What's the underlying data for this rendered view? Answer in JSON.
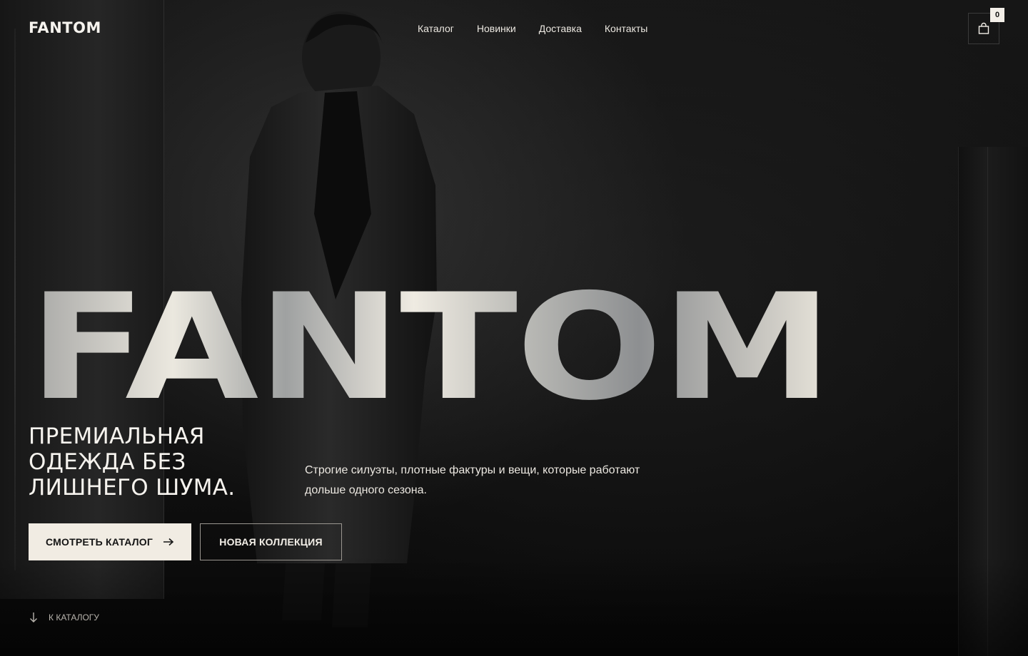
{
  "header": {
    "logo": "FANTOM",
    "nav": [
      {
        "label": "Каталог"
      },
      {
        "label": "Новинки"
      },
      {
        "label": "Доставка"
      },
      {
        "label": "Контакты"
      }
    ],
    "cart": {
      "icon": "shopping-bag-icon",
      "count": "0"
    }
  },
  "hero": {
    "title": "FANTOM",
    "tagline": "ПРЕМИАЛЬНАЯ ОДЕЖДА БЕЗ ЛИШНЕГО ШУМА.",
    "description": "Строгие силуэты, плотные фактуры и вещи, которые работают дольше одного сезона.",
    "primary_button": {
      "label": "СМОТРЕТЬ КАТАЛОГ",
      "icon": "arrow-right-icon"
    },
    "secondary_button": {
      "label": "НОВАЯ КОЛЛЕКЦИЯ"
    },
    "scroll_link": {
      "label": "К КАТАЛОГУ",
      "icon": "arrow-down-icon"
    }
  },
  "colors": {
    "background": "#0b0b0b",
    "text": "#f3efe8",
    "accent": "#f1ece3"
  }
}
